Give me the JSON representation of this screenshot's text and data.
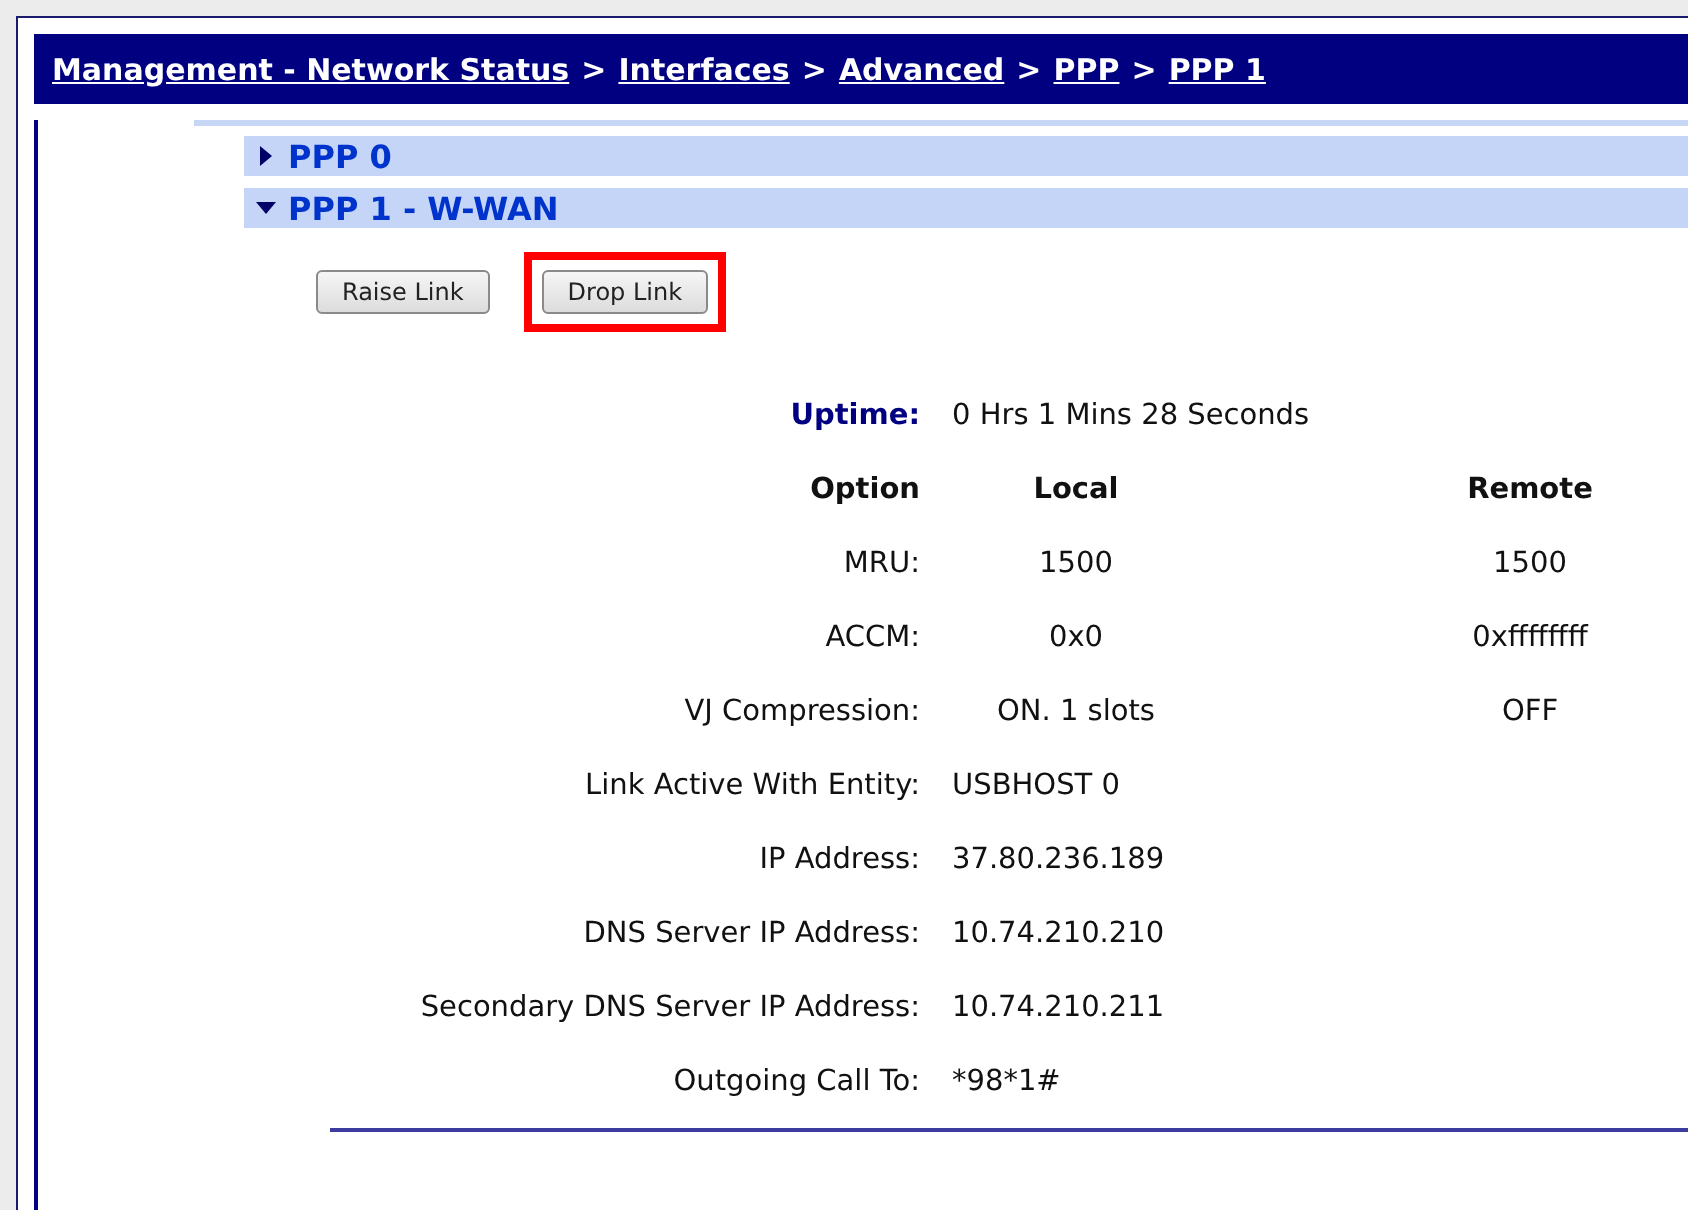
{
  "breadcrumb": [
    {
      "label": "Management - Network Status"
    },
    {
      "label": "Interfaces"
    },
    {
      "label": "Advanced"
    },
    {
      "label": "PPP"
    },
    {
      "label": "PPP 1"
    }
  ],
  "breadcrumb_separator": ">",
  "sections": [
    {
      "title": "PPP 0",
      "expanded": false
    },
    {
      "title": "PPP 1 - W-WAN",
      "expanded": true
    }
  ],
  "buttons": [
    {
      "label": "Raise Link",
      "highlighted": false
    },
    {
      "label": "Drop Link",
      "highlighted": true
    }
  ],
  "rows": [
    {
      "kind": "uptime",
      "label": "Uptime:",
      "value": "0 Hrs 1 Mins 28 Seconds"
    },
    {
      "kind": "header",
      "label": "Option",
      "local": "Local",
      "remote": "Remote"
    },
    {
      "kind": "option",
      "label": "MRU:",
      "local": "1500",
      "remote": "1500"
    },
    {
      "kind": "option",
      "label": "ACCM:",
      "local": "0x0",
      "remote": "0xffffffff"
    },
    {
      "kind": "option",
      "label": "VJ Compression:",
      "local": "ON. 1 slots",
      "remote": "OFF"
    },
    {
      "kind": "info",
      "label": "Link Active With Entity:",
      "value": "USBHOST 0"
    },
    {
      "kind": "info",
      "label": "IP Address:",
      "value": "37.80.236.189"
    },
    {
      "kind": "info",
      "label": "DNS Server IP Address:",
      "value": "10.74.210.210"
    },
    {
      "kind": "info",
      "label": "Secondary DNS Server IP Address:",
      "value": "10.74.210.211"
    },
    {
      "kind": "info",
      "label": "Outgoing Call To:",
      "value": "*98*1#"
    }
  ]
}
